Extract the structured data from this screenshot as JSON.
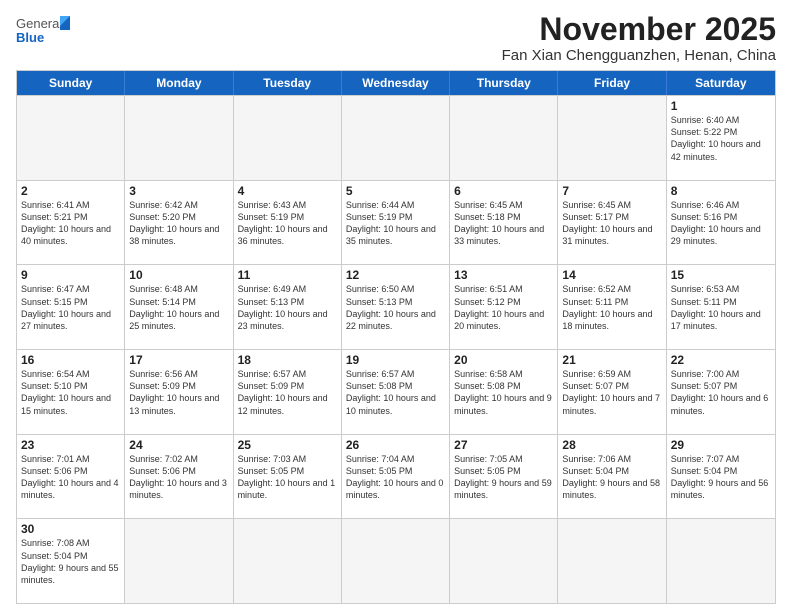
{
  "header": {
    "logo_general": "General",
    "logo_blue": "Blue",
    "month_title": "November 2025",
    "location": "Fan Xian Chengguanzhen, Henan, China"
  },
  "days_of_week": [
    "Sunday",
    "Monday",
    "Tuesday",
    "Wednesday",
    "Thursday",
    "Friday",
    "Saturday"
  ],
  "weeks": [
    [
      {
        "day": "",
        "info": ""
      },
      {
        "day": "",
        "info": ""
      },
      {
        "day": "",
        "info": ""
      },
      {
        "day": "",
        "info": ""
      },
      {
        "day": "",
        "info": ""
      },
      {
        "day": "",
        "info": ""
      },
      {
        "day": "1",
        "info": "Sunrise: 6:40 AM\nSunset: 5:22 PM\nDaylight: 10 hours and 42 minutes."
      }
    ],
    [
      {
        "day": "2",
        "info": "Sunrise: 6:41 AM\nSunset: 5:21 PM\nDaylight: 10 hours and 40 minutes."
      },
      {
        "day": "3",
        "info": "Sunrise: 6:42 AM\nSunset: 5:20 PM\nDaylight: 10 hours and 38 minutes."
      },
      {
        "day": "4",
        "info": "Sunrise: 6:43 AM\nSunset: 5:19 PM\nDaylight: 10 hours and 36 minutes."
      },
      {
        "day": "5",
        "info": "Sunrise: 6:44 AM\nSunset: 5:19 PM\nDaylight: 10 hours and 35 minutes."
      },
      {
        "day": "6",
        "info": "Sunrise: 6:45 AM\nSunset: 5:18 PM\nDaylight: 10 hours and 33 minutes."
      },
      {
        "day": "7",
        "info": "Sunrise: 6:45 AM\nSunset: 5:17 PM\nDaylight: 10 hours and 31 minutes."
      },
      {
        "day": "8",
        "info": "Sunrise: 6:46 AM\nSunset: 5:16 PM\nDaylight: 10 hours and 29 minutes."
      }
    ],
    [
      {
        "day": "9",
        "info": "Sunrise: 6:47 AM\nSunset: 5:15 PM\nDaylight: 10 hours and 27 minutes."
      },
      {
        "day": "10",
        "info": "Sunrise: 6:48 AM\nSunset: 5:14 PM\nDaylight: 10 hours and 25 minutes."
      },
      {
        "day": "11",
        "info": "Sunrise: 6:49 AM\nSunset: 5:13 PM\nDaylight: 10 hours and 23 minutes."
      },
      {
        "day": "12",
        "info": "Sunrise: 6:50 AM\nSunset: 5:13 PM\nDaylight: 10 hours and 22 minutes."
      },
      {
        "day": "13",
        "info": "Sunrise: 6:51 AM\nSunset: 5:12 PM\nDaylight: 10 hours and 20 minutes."
      },
      {
        "day": "14",
        "info": "Sunrise: 6:52 AM\nSunset: 5:11 PM\nDaylight: 10 hours and 18 minutes."
      },
      {
        "day": "15",
        "info": "Sunrise: 6:53 AM\nSunset: 5:11 PM\nDaylight: 10 hours and 17 minutes."
      }
    ],
    [
      {
        "day": "16",
        "info": "Sunrise: 6:54 AM\nSunset: 5:10 PM\nDaylight: 10 hours and 15 minutes."
      },
      {
        "day": "17",
        "info": "Sunrise: 6:56 AM\nSunset: 5:09 PM\nDaylight: 10 hours and 13 minutes."
      },
      {
        "day": "18",
        "info": "Sunrise: 6:57 AM\nSunset: 5:09 PM\nDaylight: 10 hours and 12 minutes."
      },
      {
        "day": "19",
        "info": "Sunrise: 6:57 AM\nSunset: 5:08 PM\nDaylight: 10 hours and 10 minutes."
      },
      {
        "day": "20",
        "info": "Sunrise: 6:58 AM\nSunset: 5:08 PM\nDaylight: 10 hours and 9 minutes."
      },
      {
        "day": "21",
        "info": "Sunrise: 6:59 AM\nSunset: 5:07 PM\nDaylight: 10 hours and 7 minutes."
      },
      {
        "day": "22",
        "info": "Sunrise: 7:00 AM\nSunset: 5:07 PM\nDaylight: 10 hours and 6 minutes."
      }
    ],
    [
      {
        "day": "23",
        "info": "Sunrise: 7:01 AM\nSunset: 5:06 PM\nDaylight: 10 hours and 4 minutes."
      },
      {
        "day": "24",
        "info": "Sunrise: 7:02 AM\nSunset: 5:06 PM\nDaylight: 10 hours and 3 minutes."
      },
      {
        "day": "25",
        "info": "Sunrise: 7:03 AM\nSunset: 5:05 PM\nDaylight: 10 hours and 1 minute."
      },
      {
        "day": "26",
        "info": "Sunrise: 7:04 AM\nSunset: 5:05 PM\nDaylight: 10 hours and 0 minutes."
      },
      {
        "day": "27",
        "info": "Sunrise: 7:05 AM\nSunset: 5:05 PM\nDaylight: 9 hours and 59 minutes."
      },
      {
        "day": "28",
        "info": "Sunrise: 7:06 AM\nSunset: 5:04 PM\nDaylight: 9 hours and 58 minutes."
      },
      {
        "day": "29",
        "info": "Sunrise: 7:07 AM\nSunset: 5:04 PM\nDaylight: 9 hours and 56 minutes."
      }
    ],
    [
      {
        "day": "30",
        "info": "Sunrise: 7:08 AM\nSunset: 5:04 PM\nDaylight: 9 hours and 55 minutes."
      },
      {
        "day": "",
        "info": ""
      },
      {
        "day": "",
        "info": ""
      },
      {
        "day": "",
        "info": ""
      },
      {
        "day": "",
        "info": ""
      },
      {
        "day": "",
        "info": ""
      },
      {
        "day": "",
        "info": ""
      }
    ]
  ]
}
